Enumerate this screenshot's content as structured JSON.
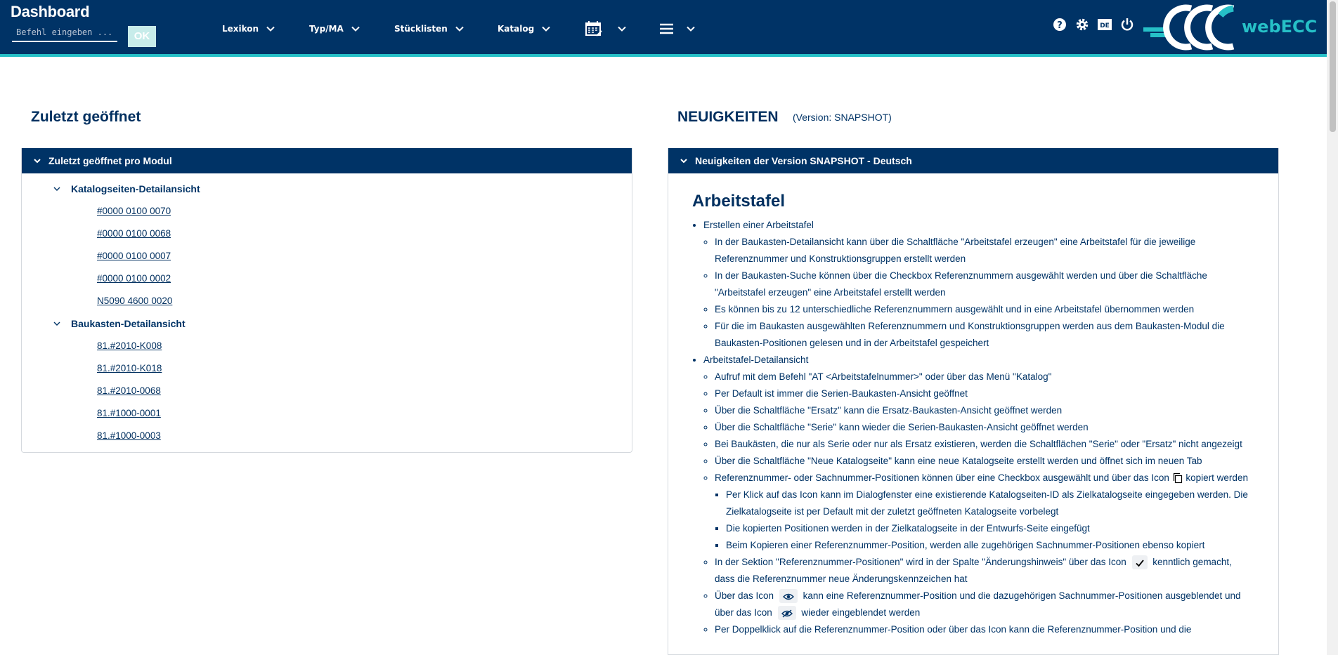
{
  "header": {
    "app_title": "Dashboard",
    "command_placeholder": "Befehl eingeben ...",
    "ok_label": "OK",
    "nav": [
      {
        "label": "Lexikon"
      },
      {
        "label": "Typ/MA"
      },
      {
        "label": "Stücklisten"
      },
      {
        "label": "Katalog"
      }
    ],
    "logo_text": "webECC",
    "lang_badge": "DE"
  },
  "left": {
    "title": "Zuletzt geöffnet",
    "panel_title": "Zuletzt geöffnet pro Modul",
    "groups": [
      {
        "label": "Katalogseiten-Detailansicht",
        "links": [
          "#0000 0100 0070",
          "#0000 0100 0068",
          "#0000 0100 0007",
          "#0000 0100 0002",
          "N5090 4600 0020"
        ]
      },
      {
        "label": "Baukasten-Detailansicht",
        "links": [
          "81.#2010-K008",
          "81.#2010-K018",
          "81.#2010-0068",
          "81.#1000-0001",
          "81.#1000-0003"
        ]
      }
    ]
  },
  "right": {
    "title": "NEUIGKEITEN",
    "version_note": "(Version: SNAPSHOT)",
    "panel_title": "Neuigkeiten der Version SNAPSHOT - Deutsch",
    "heading": "Arbeitstafel",
    "b1": "Erstellen einer Arbeitstafel",
    "b1_items": [
      "In der Baukasten-Detailansicht kann über die Schaltfläche \"Arbeitstafel erzeugen\" eine Arbeitstafel für die jeweilige Referenznummer und Konstruktionsgruppen erstellt werden",
      "In der Baukasten-Suche können über die Checkbox Referenznummern ausgewählt werden und über die Schaltfläche \"Arbeitstafel erzeugen\" eine Arbeitstafel erstellt werden",
      "Es können bis zu 12 unterschiedliche Referenznummern ausgewählt und in eine Arbeitstafel übernommen werden",
      "Für die im Baukasten ausgewählten Referenznummern und Konstruktionsgruppen werden aus dem Baukasten-Modul die Baukasten-Positionen gelesen und in der Arbeitstafel gespeichert"
    ],
    "b2": "Arbeitstafel-Detailansicht",
    "b2_items": [
      "Aufruf mit dem Befehl \"AT <Arbeitstafelnummer>\" oder über das Menü \"Katalog\"",
      "Per Default ist immer die Serien-Baukasten-Ansicht geöffnet",
      "Über die Schaltfläche \"Ersatz\" kann die Ersatz-Baukasten-Ansicht geöffnet werden",
      "Über die Schaltfläche \"Serie\" kann wieder die Serien-Baukasten-Ansicht geöffnet werden",
      "Bei Baukästen, die nur als Serie oder nur als Ersatz existieren, werden die Schaltflächen \"Serie\" oder \"Ersatz\" nicht angezeigt",
      "Über die Schaltfläche \"Neue Katalogseite\" kann eine neue Katalogseite erstellt werden und öffnet sich im neuen Tab"
    ],
    "copy_pre": "Referenznummer- oder Sachnummer-Positionen können über eine Checkbox ausgewählt und über das Icon",
    "copy_post": "kopiert werden",
    "copy_sub": [
      "Per Klick auf das Icon kann im Dialogfenster eine existierende Katalogseiten-ID als Zielkatalogseite eingegeben werden. Die Zielkatalogseite ist per Default mit der zuletzt geöffneten Katalogseite vorbelegt",
      "Die kopierten Positionen werden in der Zielkatalogseite in der Entwurfs-Seite eingefügt",
      "Beim Kopieren einer Referenznummer-Position, werden alle zugehörigen Sachnummer-Positionen ebenso kopiert"
    ],
    "check_pre": "In der Sektion \"Referenznummer-Positionen\" wird in der Spalte \"Änderungshinweis\" über das Icon",
    "check_post": "kenntlich gemacht, dass die Referenznummer neue Änderungskennzeichen hat",
    "eye_pre": "Über das Icon",
    "eye_mid": "kann eine Referenznummer-Position und die dazugehörigen Sachnummer-Positionen ausgeblendet und über das Icon",
    "eye_post": "wieder eingeblendet werden",
    "last_line": "Per Doppelklick auf die Referenznummer-Position oder über das Icon kann die Referenznummer-Position und die"
  }
}
